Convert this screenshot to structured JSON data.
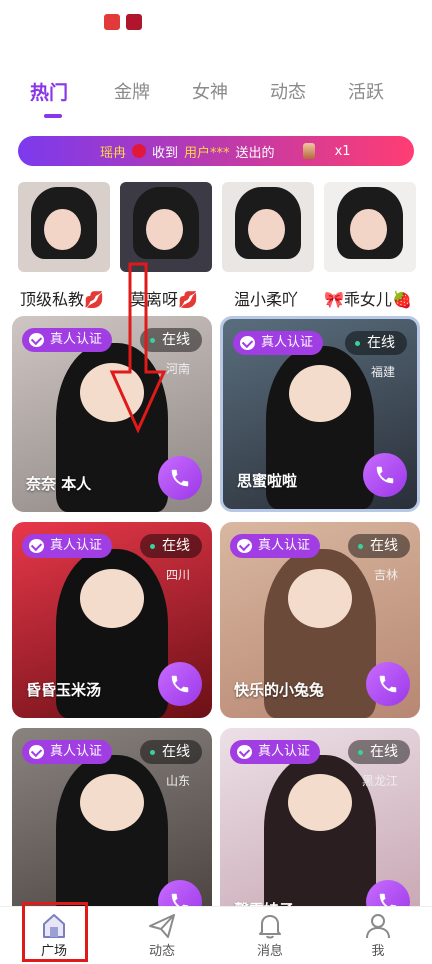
{
  "tabs": [
    {
      "label": "热门",
      "active": true
    },
    {
      "label": "金牌",
      "active": false
    },
    {
      "label": "女神",
      "active": false
    },
    {
      "label": "动态",
      "active": false
    },
    {
      "label": "活跃",
      "active": false
    }
  ],
  "banner": {
    "sender": "瑶冉",
    "received_text": "收到",
    "recipient": "用户***",
    "sent_text": "送出的",
    "count": "x1"
  },
  "top_users": [
    {
      "name": "顶级私教"
    },
    {
      "name": "莫离呀"
    },
    {
      "name": "温小柔吖"
    },
    {
      "name": "乖女儿"
    }
  ],
  "cards": [
    {
      "verified": "真人认证",
      "status": "在线",
      "region": "河南",
      "name": "奈奈 本人"
    },
    {
      "verified": "真人认证",
      "status": "在线",
      "region": "福建",
      "name": "思蜜啦啦"
    },
    {
      "verified": "真人认证",
      "status": "在线",
      "region": "四川",
      "name": "昏昏玉米汤"
    },
    {
      "verified": "真人认证",
      "status": "在线",
      "region": "吉林",
      "name": "快乐的小兔兔"
    },
    {
      "verified": "真人认证",
      "status": "在线",
      "region": "山东",
      "name": ""
    },
    {
      "verified": "真人认证",
      "status": "在线",
      "region": "黑龙江",
      "name": "馨雪娃子"
    }
  ],
  "nav": [
    {
      "label": "广场",
      "icon": "home-icon",
      "active": true
    },
    {
      "label": "动态",
      "icon": "paper-plane-icon",
      "active": false
    },
    {
      "label": "消息",
      "icon": "bell-icon",
      "active": false
    },
    {
      "label": "我",
      "icon": "person-icon",
      "active": false
    }
  ],
  "colors": {
    "accent": "#8a35e6",
    "verified_badge": "#a13ee3",
    "online_dot": "#36d39a",
    "annotation_red": "#e01919"
  }
}
